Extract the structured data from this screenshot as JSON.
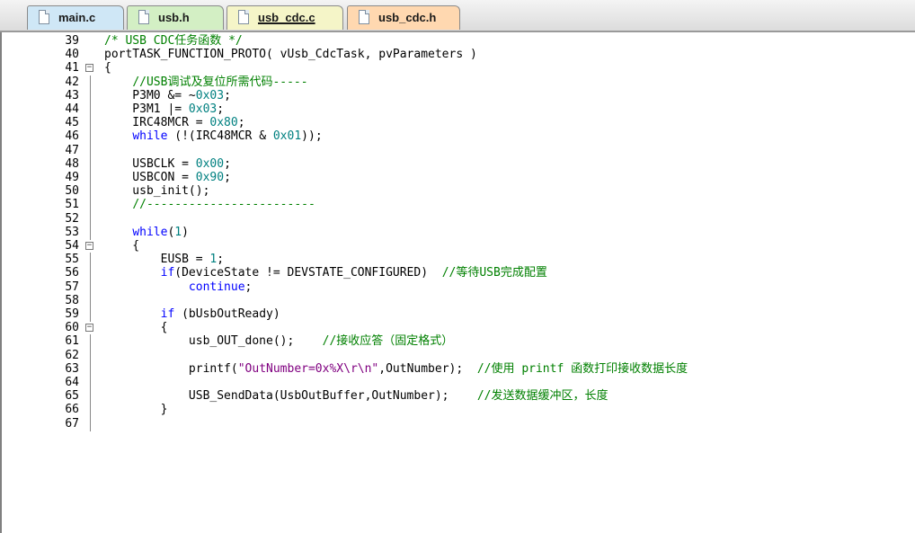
{
  "tabs": [
    {
      "label": "main.c",
      "bg": "#cfe7f6",
      "active": false
    },
    {
      "label": "usb.h",
      "bg": "#d3efc4",
      "active": false
    },
    {
      "label": "usb_cdc.c",
      "bg": "#f5f5c8",
      "active": true
    },
    {
      "label": "usb_cdc.h",
      "bg": "#ffd8b0",
      "active": false
    }
  ],
  "colors": {
    "comment": "#008000",
    "keyword": "#0000ff",
    "number": "#008080",
    "string": "#800080",
    "text": "#000000"
  },
  "editor": {
    "lines": [
      {
        "num": "39",
        "fold": "none",
        "tokens": [
          [
            "/* USB CDC任务函数 */",
            "cm"
          ]
        ]
      },
      {
        "num": "40",
        "fold": "none",
        "tokens": [
          [
            "portTASK_FUNCTION_PROTO( vUsb_CdcTask, pvParameters )",
            ""
          ]
        ]
      },
      {
        "num": "41",
        "fold": "open",
        "tokens": [
          [
            "{",
            ""
          ]
        ]
      },
      {
        "num": "42",
        "fold": "line",
        "tokens": [
          [
            "    ",
            ""
          ],
          [
            "//USB调试及复位所需代码-----",
            "cm"
          ]
        ]
      },
      {
        "num": "43",
        "fold": "line",
        "tokens": [
          [
            "    P3M0 &= ~",
            ""
          ],
          [
            "0x03",
            "num"
          ],
          [
            ";",
            ""
          ]
        ]
      },
      {
        "num": "44",
        "fold": "line",
        "tokens": [
          [
            "    P3M1 |= ",
            ""
          ],
          [
            "0x03",
            "num"
          ],
          [
            ";",
            ""
          ]
        ]
      },
      {
        "num": "45",
        "fold": "line",
        "tokens": [
          [
            "    IRC48MCR = ",
            ""
          ],
          [
            "0x80",
            "num"
          ],
          [
            ";",
            ""
          ]
        ]
      },
      {
        "num": "46",
        "fold": "line",
        "tokens": [
          [
            "    ",
            ""
          ],
          [
            "while",
            "kw"
          ],
          [
            " (!(IRC48MCR & ",
            ""
          ],
          [
            "0x01",
            "num"
          ],
          [
            "));",
            ""
          ]
        ]
      },
      {
        "num": "47",
        "fold": "line",
        "tokens": []
      },
      {
        "num": "48",
        "fold": "line",
        "tokens": [
          [
            "    USBCLK = ",
            ""
          ],
          [
            "0x00",
            "num"
          ],
          [
            ";",
            ""
          ]
        ]
      },
      {
        "num": "49",
        "fold": "line",
        "tokens": [
          [
            "    USBCON = ",
            ""
          ],
          [
            "0x90",
            "num"
          ],
          [
            ";",
            ""
          ]
        ]
      },
      {
        "num": "50",
        "fold": "line",
        "tokens": [
          [
            "    usb_init();",
            ""
          ]
        ]
      },
      {
        "num": "51",
        "fold": "line",
        "tokens": [
          [
            "    ",
            ""
          ],
          [
            "//------------------------",
            "cm"
          ]
        ]
      },
      {
        "num": "52",
        "fold": "line",
        "tokens": []
      },
      {
        "num": "53",
        "fold": "line",
        "tokens": [
          [
            "    ",
            ""
          ],
          [
            "while",
            "kw"
          ],
          [
            "(",
            ""
          ],
          [
            "1",
            "num"
          ],
          [
            ")",
            ""
          ]
        ]
      },
      {
        "num": "54",
        "fold": "open",
        "tokens": [
          [
            "    {",
            ""
          ]
        ]
      },
      {
        "num": "55",
        "fold": "line",
        "tokens": [
          [
            "        EUSB = ",
            ""
          ],
          [
            "1",
            "num"
          ],
          [
            ";",
            ""
          ]
        ]
      },
      {
        "num": "56",
        "fold": "line",
        "tokens": [
          [
            "        ",
            ""
          ],
          [
            "if",
            "kw"
          ],
          [
            "(DeviceState != DEVSTATE_CONFIGURED)  ",
            ""
          ],
          [
            "//等待USB完成配置",
            "cm"
          ]
        ]
      },
      {
        "num": "57",
        "fold": "line",
        "tokens": [
          [
            "            ",
            ""
          ],
          [
            "continue",
            "kw"
          ],
          [
            ";",
            ""
          ]
        ]
      },
      {
        "num": "58",
        "fold": "line",
        "tokens": []
      },
      {
        "num": "59",
        "fold": "line",
        "tokens": [
          [
            "        ",
            ""
          ],
          [
            "if",
            "kw"
          ],
          [
            " (bUsbOutReady)",
            ""
          ]
        ]
      },
      {
        "num": "60",
        "fold": "open",
        "tokens": [
          [
            "        {",
            ""
          ]
        ]
      },
      {
        "num": "61",
        "fold": "line",
        "tokens": [
          [
            "            usb_OUT_done();    ",
            ""
          ],
          [
            "//接收应答（固定格式）",
            "cm"
          ]
        ]
      },
      {
        "num": "62",
        "fold": "line",
        "tokens": []
      },
      {
        "num": "63",
        "fold": "line",
        "tokens": [
          [
            "            printf(",
            ""
          ],
          [
            "\"OutNumber=0x%X\\r\\n\"",
            "str"
          ],
          [
            ",OutNumber);  ",
            ""
          ],
          [
            "//使用 printf 函数打印接收数据长度",
            "cm"
          ]
        ]
      },
      {
        "num": "64",
        "fold": "line",
        "tokens": []
      },
      {
        "num": "65",
        "fold": "line",
        "tokens": [
          [
            "            USB_SendData(UsbOutBuffer,OutNumber);    ",
            ""
          ],
          [
            "//发送数据缓冲区，长度",
            "cm"
          ]
        ]
      },
      {
        "num": "66",
        "fold": "line",
        "tokens": [
          [
            "        }",
            ""
          ]
        ]
      },
      {
        "num": "67",
        "fold": "line",
        "tokens": []
      }
    ]
  }
}
